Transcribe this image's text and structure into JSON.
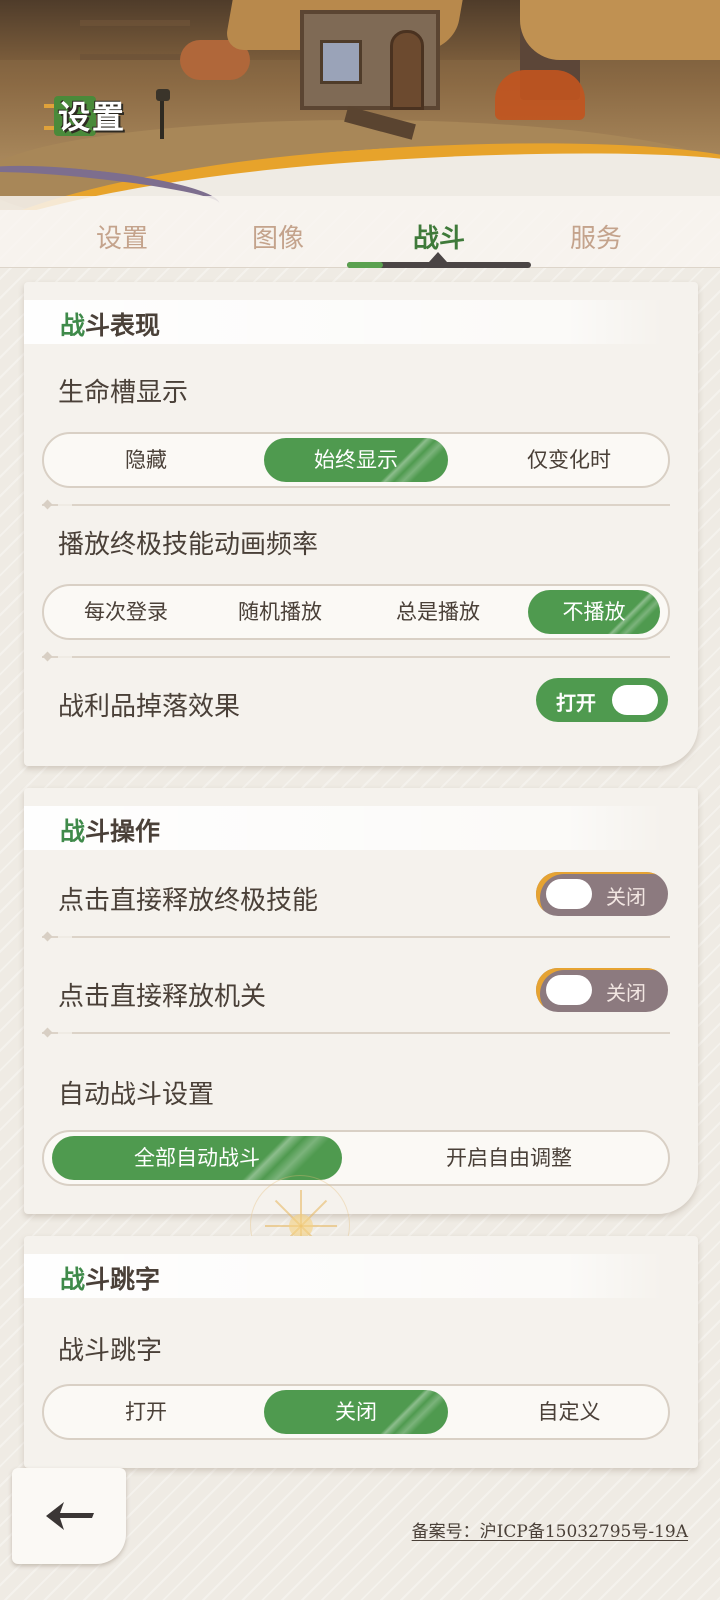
{
  "header": {
    "logo_text": "设置"
  },
  "tabs": [
    {
      "label": "设置",
      "active": false
    },
    {
      "label": "图像",
      "active": false
    },
    {
      "label": "战斗",
      "active": true
    },
    {
      "label": "服务",
      "active": false
    }
  ],
  "sections": {
    "performance": {
      "title_accent": "战",
      "title_rest": "斗表现",
      "hp_bar": {
        "label": "生命槽显示",
        "options": [
          "隐藏",
          "始终显示",
          "仅变化时"
        ],
        "selected": "始终显示"
      },
      "ult_anim": {
        "label": "播放终极技能动画频率",
        "options": [
          "每次登录",
          "随机播放",
          "总是播放",
          "不播放"
        ],
        "selected": "不播放"
      },
      "loot_effect": {
        "label": "战利品掉落效果",
        "state": "打开"
      }
    },
    "operation": {
      "title_accent": "战",
      "title_rest": "斗操作",
      "tap_ult": {
        "label": "点击直接释放终极技能",
        "state": "关闭"
      },
      "tap_mech": {
        "label": "点击直接释放机关",
        "state": "关闭"
      },
      "auto_battle": {
        "label": "自动战斗设置",
        "options": [
          "全部自动战斗",
          "开启自由调整"
        ],
        "selected": "全部自动战斗"
      }
    },
    "damage_text": {
      "title_accent": "战",
      "title_rest": "斗跳字",
      "setting": {
        "label": "战斗跳字",
        "options": [
          "打开",
          "关闭",
          "自定义"
        ],
        "selected": "关闭"
      }
    }
  },
  "footer": {
    "icp": "备案号：沪ICP备15032795号-19A"
  },
  "icons": {
    "back": "back-arrow-icon"
  },
  "colors": {
    "accent_green": "#4f9a4f",
    "toggle_off": "#8c7a7f",
    "gold": "#e7a32b"
  }
}
